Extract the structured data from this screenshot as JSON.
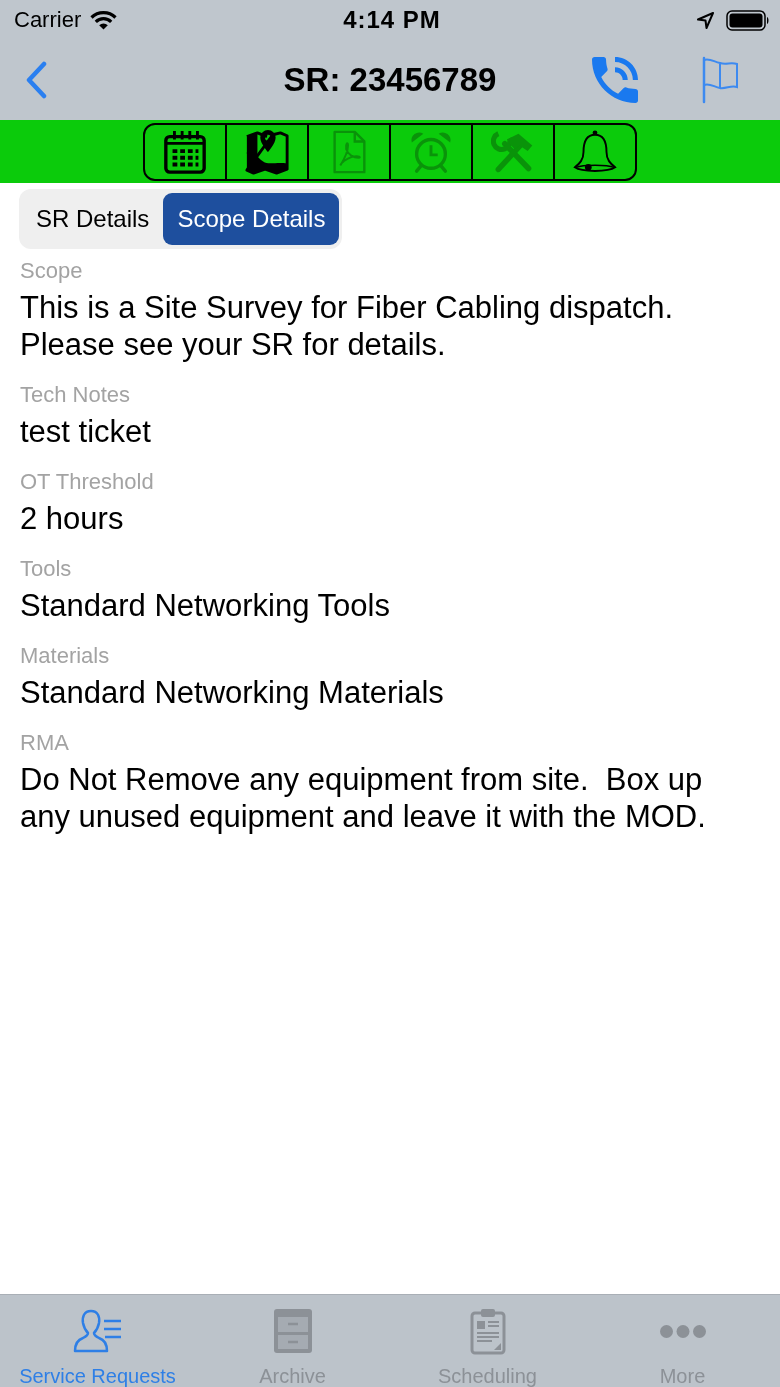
{
  "status_bar": {
    "carrier": "Carrier",
    "time": "4:14 PM"
  },
  "nav_bar": {
    "title": "SR: 23456789"
  },
  "toolbar": {
    "items": [
      {
        "kind": "calendar",
        "disabled": false
      },
      {
        "kind": "map",
        "disabled": false
      },
      {
        "kind": "document",
        "disabled": true
      },
      {
        "kind": "alarm",
        "disabled": true
      },
      {
        "kind": "tools",
        "disabled": true
      },
      {
        "kind": "bell",
        "disabled": false
      }
    ]
  },
  "segments": [
    {
      "label": "SR Details",
      "selected": false
    },
    {
      "label": "Scope Details",
      "selected": true
    }
  ],
  "fields": [
    {
      "label": "Scope",
      "value": "This is a Site Survey for Fiber Cabling dispatch. Please see your SR for details."
    },
    {
      "label": "Tech Notes",
      "value": "test ticket"
    },
    {
      "label": "OT Threshold",
      "value": "2 hours"
    },
    {
      "label": "Tools",
      "value": "Standard Networking Tools"
    },
    {
      "label": "Materials",
      "value": "Standard Networking Materials"
    },
    {
      "label": "RMA",
      "value": "Do Not Remove any equipment from site.  Box up any unused equipment and leave it with the MOD."
    }
  ],
  "tab_bar": {
    "items": [
      {
        "kind": "person-list",
        "label": "Service Requests",
        "selected": true
      },
      {
        "kind": "cabinet",
        "label": "Archive",
        "selected": false
      },
      {
        "kind": "clipboard",
        "label": "Scheduling",
        "selected": false
      },
      {
        "kind": "dots",
        "label": "More",
        "selected": false
      }
    ]
  }
}
